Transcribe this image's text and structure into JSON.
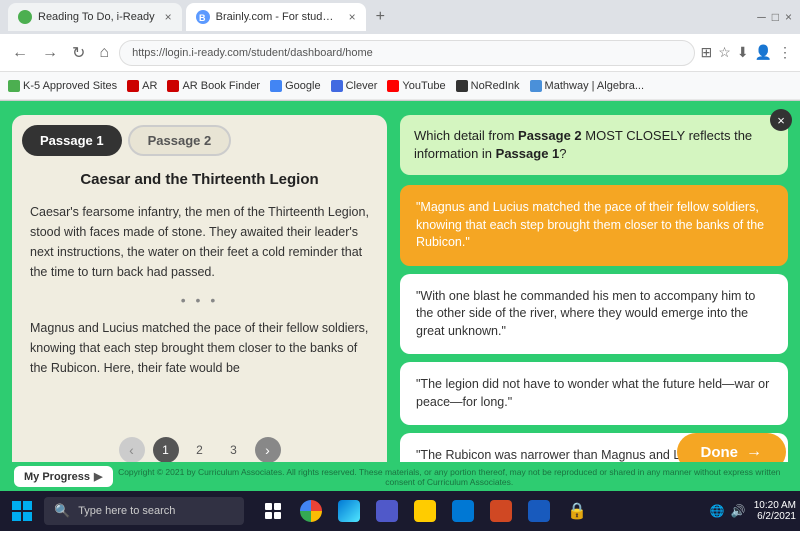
{
  "browser": {
    "tabs": [
      {
        "id": "tab1",
        "title": "Reading To Do, i-Ready",
        "active": false,
        "favicon_color": "#4CAF50"
      },
      {
        "id": "tab2",
        "title": "Brainly.com - For students, By st...",
        "active": true,
        "favicon_color": "#5c9aff"
      }
    ],
    "address": "https://login.i-ready.com/student/dashboard/home",
    "bookmarks": [
      {
        "label": "K-5 Approved Sites",
        "color": "#4CAF50"
      },
      {
        "label": "AR",
        "color": "#cc0000"
      },
      {
        "label": "AR Book Finder",
        "color": "#cc0000"
      },
      {
        "label": "Google",
        "color": "#4285f4"
      },
      {
        "label": "Clever",
        "color": "#4169e1"
      },
      {
        "label": "YouTube",
        "color": "#ff0000"
      },
      {
        "label": "NoRedInk",
        "color": "#333"
      },
      {
        "label": "Mathway | Algebra...",
        "color": "#4a90d9"
      }
    ]
  },
  "app": {
    "close_label": "×",
    "passage_tab1": "Passage 1",
    "passage_tab2": "Passage 2",
    "passage_title": "Caesar and the Thirteenth Legion",
    "passage_paragraph1": "Caesar's fearsome infantry, the men of the Thirteenth Legion, stood with faces made of stone. They awaited their leader's next instructions, the water on their feet a cold reminder that the time to turn back had passed.",
    "passage_dots": "• • •",
    "passage_paragraph2": "Magnus and Lucius matched the pace of their fellow soldiers, knowing that each step brought them closer to the banks of the Rubicon. Here, their fate would be",
    "pagination": {
      "pages": [
        "1",
        "2",
        "3"
      ],
      "active": 1
    },
    "question": {
      "text": "Which detail from ",
      "bold1": "Passage 2",
      "mid": " MOST CLOSELY reflects the information in ",
      "bold2": "Passage 1",
      "end": "?"
    },
    "answers": [
      {
        "id": "a1",
        "text": "\"Magnus and Lucius matched the pace of their fellow soldiers, knowing that each step brought them closer to the banks of the Rubicon.\"",
        "selected": true
      },
      {
        "id": "a2",
        "text": "\"With one blast he commanded his men to accompany him to the other side of the river, where they would emerge into the great unknown.\"",
        "selected": false
      },
      {
        "id": "a3",
        "text": "\"The legion did not have to wonder what the future held—war or peace—for long.\"",
        "selected": false
      },
      {
        "id": "a4",
        "text": "\"The Rubicon was narrower than Magnus and Lucius, knowing its significance, had imagined.\"",
        "selected": false
      }
    ],
    "done_label": "Done",
    "my_progress_label": "My Progress",
    "copyright": "Copyright © 2021 by Curriculum Associates. All rights reserved. These materials, or any portion thereof, may not be reproduced or shared in any manner without express written consent of Curriculum Associates."
  },
  "taskbar": {
    "search_placeholder": "Type here to search",
    "time": "10:20 AM",
    "date": "6/2/2021"
  }
}
